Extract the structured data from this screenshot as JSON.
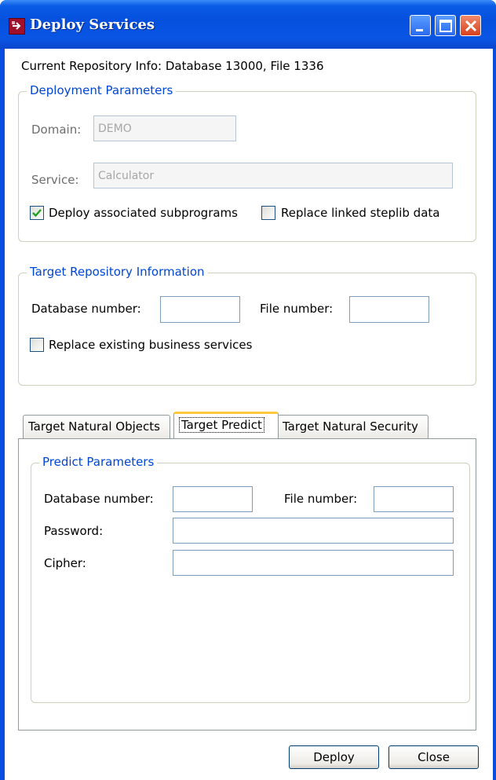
{
  "window": {
    "title": "Deploy Services"
  },
  "repo_info": "Current Repository Info: Database 13000, File 1336",
  "deployment": {
    "legend": "Deployment Parameters",
    "domain_label": "Domain:",
    "domain_value": "DEMO",
    "service_label": "Service:",
    "service_value": "Calculator",
    "deploy_subprograms_label": "Deploy associated subprograms",
    "deploy_subprograms_checked": true,
    "replace_steplib_label": "Replace linked steplib data",
    "replace_steplib_checked": false
  },
  "target_repo": {
    "legend": "Target Repository Information",
    "db_label": "Database number:",
    "db_value": "",
    "file_label": "File number:",
    "file_value": "",
    "replace_services_label": "Replace existing business services",
    "replace_services_checked": false
  },
  "tabs": [
    {
      "label": "Target Natural Objects",
      "active": false
    },
    {
      "label": "Target Predict",
      "active": true
    },
    {
      "label": "Target Natural Security",
      "active": false
    }
  ],
  "predict": {
    "legend": "Predict Parameters",
    "db_label": "Database number:",
    "db_value": "",
    "file_label": "File number:",
    "file_value": "",
    "password_label": "Password:",
    "password_value": "",
    "cipher_label": "Cipher:",
    "cipher_value": ""
  },
  "buttons": {
    "deploy": "Deploy",
    "close": "Close"
  }
}
